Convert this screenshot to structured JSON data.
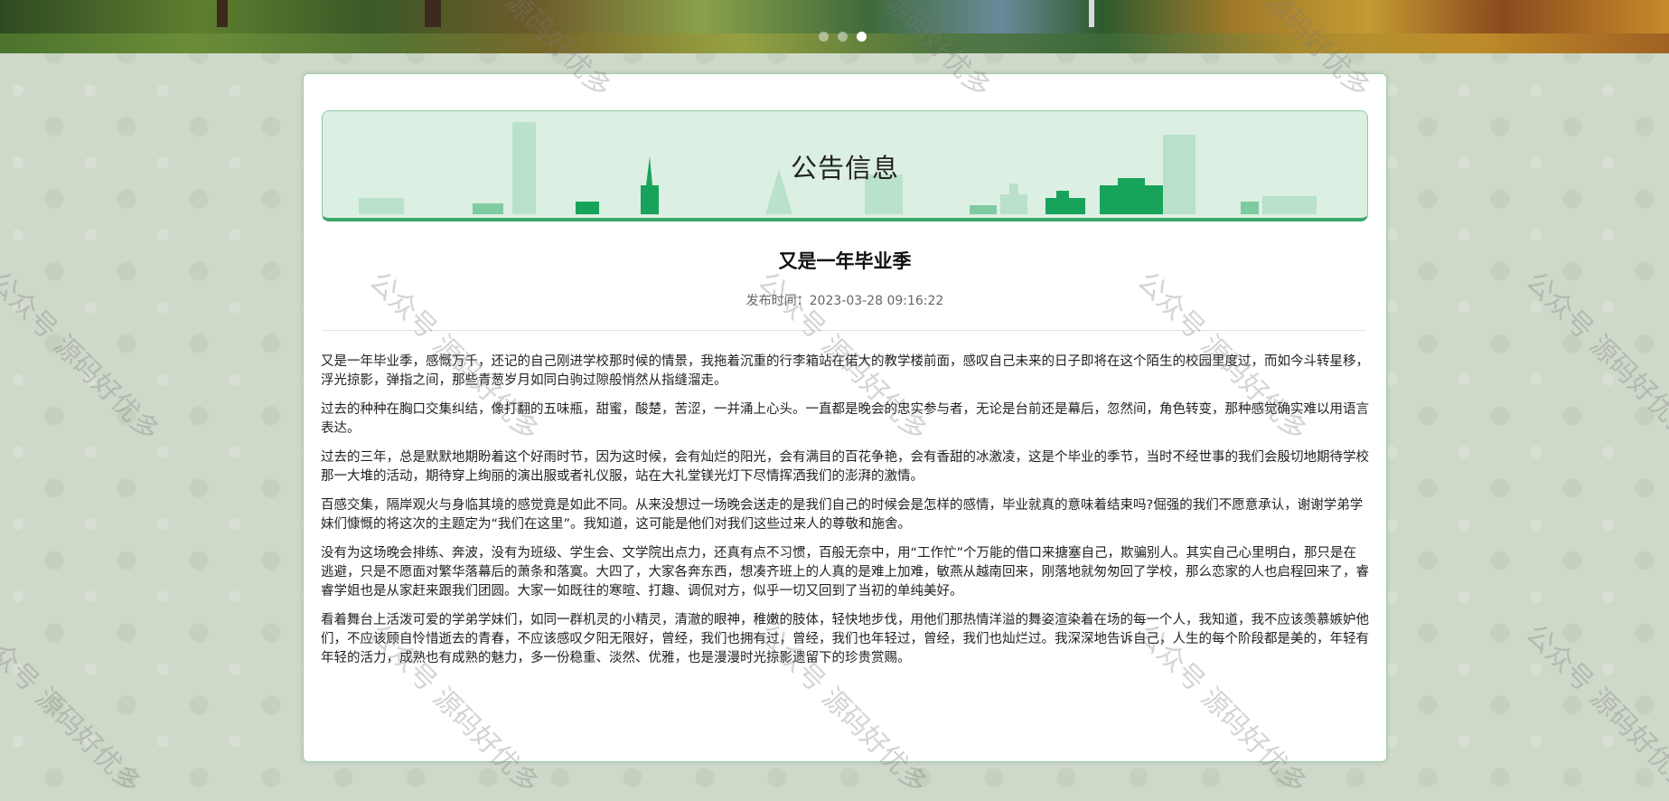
{
  "watermark": "公众号 源码好优多",
  "carousel": {
    "dot_count": 3,
    "active_index": 2
  },
  "header": {
    "title": "公告信息"
  },
  "article": {
    "title": "又是一年毕业季",
    "publish_time": "发布时间：2023-03-28 09:16:22",
    "paragraphs": [
      "又是一年毕业季，感慨万千，还记的自己刚进学校那时候的情景，我拖着沉重的行李箱站在偌大的教学楼前面，感叹自己未来的日子即将在这个陌生的校园里度过，而如今斗转星移，浮光掠影，弹指之间，那些青葱岁月如同白驹过隙般悄然从指缝溜走。",
      "过去的种种在胸口交集纠结，像打翻的五味瓶，甜蜜，酸楚，苦涩，一并涌上心头。一直都是晚会的忠实参与者，无论是台前还是幕后，忽然间，角色转变，那种感觉确实难以用语言表达。",
      "过去的三年，总是默默地期盼着这个好雨时节，因为这时候，会有灿烂的阳光，会有满目的百花争艳，会有香甜的冰激凌，这是个毕业的季节，当时不经世事的我们会殷切地期待学校那一大堆的活动，期待穿上绚丽的演出服或者礼仪服，站在大礼堂镁光灯下尽情挥洒我们的澎湃的激情。",
      "百感交集，隔岸观火与身临其境的感觉竟是如此不同。从来没想过一场晚会送走的是我们自己的时候会是怎样的感情，毕业就真的意味着结束吗?倔强的我们不愿意承认，谢谢学弟学妹们慷慨的将这次的主题定为“我们在这里”。我知道，这可能是他们对我们这些过来人的尊敬和施舍。",
      "没有为这场晚会排练、奔波，没有为班级、学生会、文学院出点力，还真有点不习惯，百般无奈中，用“工作忙”个万能的借口来搪塞自己，欺骗别人。其实自己心里明白，那只是在逃避，只是不愿面对繁华落幕后的萧条和落寞。大四了，大家各奔东西，想凑齐班上的人真的是难上加难，敏燕从越南回来，刚落地就匆匆回了学校，那么恋家的人也启程回来了，睿睿学姐也是从家赶来跟我们团圆。大家一如既往的寒暄、打趣、调侃对方，似乎一切又回到了当初的单纯美好。",
      "看着舞台上活泼可爱的学弟学妹们，如同一群机灵的小精灵，清澈的眼神，稚嫩的肢体，轻快地步伐，用他们那热情洋溢的舞姿渲染着在场的每一个人，我知道，我不应该羡慕嫉妒他们，不应该顾自怜惜逝去的青春，不应该感叹夕阳无限好，曾经，我们也拥有过，曾经，我们也年轻过，曾经，我们也灿烂过。我深深地告诉自己，人生的每个阶段都是美的，年轻有年轻的活力，成熟也有成熟的魅力，多一份稳重、淡然、优雅，也是漫漫时光掠影遗留下的珍贵赏赐。"
    ]
  }
}
